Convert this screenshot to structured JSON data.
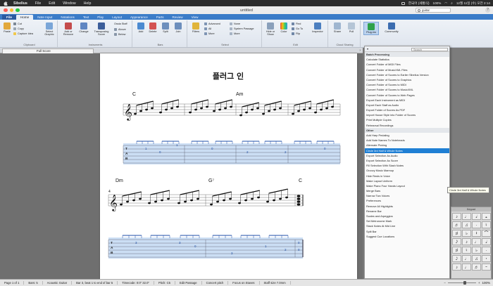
{
  "menubar": {
    "app": "Sibelius",
    "items": [
      "File",
      "Edit",
      "Window",
      "Help"
    ],
    "status_input": "한국어 (세벌식)",
    "status_battery": "100%",
    "status_datetime": "12월 11일 (수) 오전 2:14"
  },
  "window": {
    "title": "untitled",
    "search_value": "guitar"
  },
  "ribbon": {
    "tabs": [
      "File",
      "Home",
      "Note Input",
      "Notations",
      "Text",
      "Play",
      "Layout",
      "Appearance",
      "Parts",
      "Review",
      "View"
    ],
    "active_tab": "Home",
    "groups": {
      "clipboard": {
        "label": "Clipboard",
        "paste": "Paste",
        "cut": "Cut",
        "copy": "Copy",
        "capture": "Capture Idea",
        "select_graphic": "Select Graphic"
      },
      "instruments": {
        "label": "Instruments",
        "add": "Add or Remove",
        "change": "Change",
        "transposing": "Transposing Score",
        "ossia": "Ossia Staff",
        "above": "Above",
        "below": "Below"
      },
      "bars": {
        "label": "Bars",
        "add": "Add",
        "delete": "Delete",
        "split": "Split",
        "join": "Join"
      },
      "select": {
        "label": "Select",
        "filters": "Filters",
        "advanced": "Advanced",
        "all": "All",
        "more": "More",
        "none": "None",
        "system_passage": "System Passage",
        "more2": "More"
      },
      "edit": {
        "label": "Edit",
        "hide_show": "Hide or Show",
        "color": "Color",
        "find": "Find",
        "goto": "Go To",
        "flip": "Flip",
        "inspector": "Inspector"
      },
      "cloud": {
        "label": "Cloud Sharing",
        "share": "Share",
        "pull": "Pull"
      },
      "plugins": {
        "label": "Plug-ins",
        "community": "Community"
      }
    }
  },
  "docbar": {
    "tab": "Full Score"
  },
  "score": {
    "title": "플러그 인",
    "chords_row1": [
      "C",
      "Am"
    ],
    "chords_row2": [
      "Dm",
      "G⁷",
      "C"
    ],
    "tab_row1": [
      "1",
      "0",
      "1",
      "0",
      "2",
      "2",
      "0"
    ],
    "tab_row2": [
      "3",
      "3",
      "0",
      "3",
      "1",
      "2",
      "0",
      "0"
    ]
  },
  "plugins_menu": {
    "search_placeholder": "Search",
    "header1": "Batch Processing",
    "batch_items": [
      "Calculate Statistics",
      "Convert Folder of MIDI Files",
      "Convert Folder of MusicXML Files",
      "Convert Folder of Scores to Earlier Sibelius Version",
      "Convert Folder of Scores to Graphics",
      "Convert Folder of Scores to MIDI",
      "Convert Folder of Scores to MusicXML",
      "Convert Folder of Scores to Web Pages",
      "Export Each Instrument as MIDI",
      "Export Each Staff as Audio",
      "Export Folder of Scores As PDF",
      "Import House Style into Folder of Scores",
      "Print Multiple Copies",
      "Rehearsal Recordings"
    ],
    "header2": "Other",
    "other_items": [
      "Add Harp Pedaling",
      "Add Note Names To Noteheads",
      "Alternate Picking",
      "Circle 3rd Half & Whole Notes",
      "Export Selection As Audio",
      "Export Selection As Score",
      "Fill Selection With Slash Notes",
      "Groovy Music Marmup",
      "Hide Rests in Voice",
      "Make Layout Uniform",
      "Make Piano Four Hands Layout",
      "Merge Bars",
      "Narrow Two Voices",
      "Preferences",
      "Remove All Highlights",
      "Rename Bar",
      "Scales and Arpeggios",
      "Set Metronome Mark",
      "Stack Notes At Mid Line",
      "Split Bar",
      "Suggest Cue Locations"
    ],
    "selected": "Circle 3rd Half & Whole Notes"
  },
  "tooltip": "Circle 3rd Half & Whole Notes",
  "palette": {
    "title": "Keypad"
  },
  "statusbar": {
    "items": [
      "Page 1 of 1",
      "Bars: 5",
      "Acoustic Guitar",
      "Bar 3, beat 1 to end of bar 5",
      "Timecode: 0:0\" 32.0\"",
      "Pitch: C5",
      "Edit Passage",
      "Concert pitch",
      "Focus on Staves",
      "Staff size 7.0mm"
    ],
    "zoom": "100%"
  },
  "colors": {
    "ribbon_blue": "#3b7cc8",
    "selection_blue": "#1f7fd4",
    "tab_highlight": "#bcd3ef"
  }
}
